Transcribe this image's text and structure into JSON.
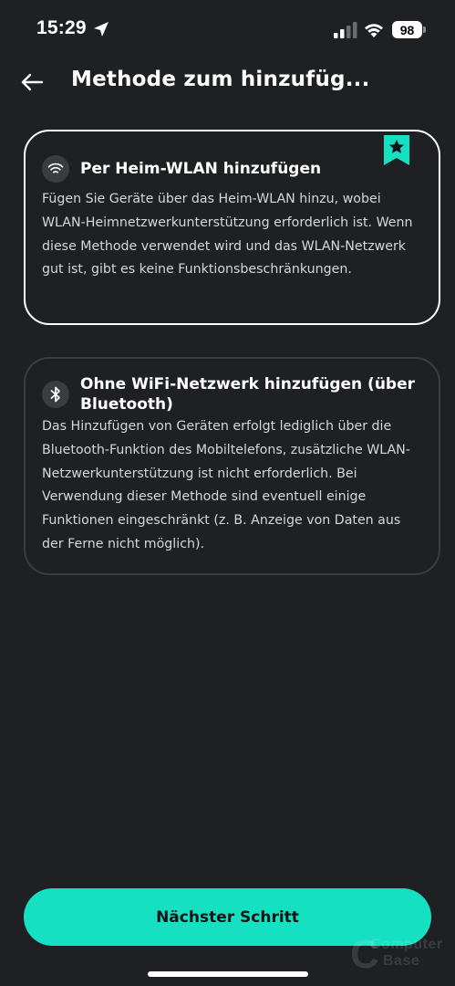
{
  "status_bar": {
    "time": "15:29",
    "battery_level": "98",
    "icons": [
      "location-arrow-icon",
      "signal-icon",
      "wifi-icon",
      "battery-icon"
    ]
  },
  "header": {
    "title": "Methode zum hinzufüg...",
    "back_icon": "arrow-left-icon"
  },
  "methods": [
    {
      "icon": "wifi-icon",
      "title": "Per Heim-WLAN hinzufügen",
      "description": "Fügen Sie Geräte über das Heim-WLAN hinzu, wobei WLAN-Heimnetzwerkunterstützung erforderlich ist. Wenn diese Methode verwendet wird und das WLAN-Netzwerk gut ist, gibt es keine Funktionsbeschränkungen.",
      "selected": true,
      "recommended_icon": "star-ribbon-icon"
    },
    {
      "icon": "bluetooth-icon",
      "title": "Ohne WiFi-Netzwerk hinzufügen (über Bluetooth)",
      "description": "Das Hinzufügen von Geräten erfolgt lediglich über die Bluetooth-Funktion des Mobiltelefons, zusätzliche WLAN-Netzwerkunterstützung ist nicht erforderlich. Bei Verwendung dieser Methode sind eventuell einige Funktionen eingeschränkt (z. B. Anzeige von Daten aus der Ferne nicht möglich).",
      "selected": false
    }
  ],
  "footer": {
    "next_button_label": "Nächster Schritt"
  },
  "watermark": {
    "line1": "Computer",
    "line2": "Base"
  },
  "colors": {
    "background": "#1f2024",
    "accent": "#16e0c2",
    "card_selected_border": "#ffffff",
    "card_border": "#3a3c41"
  }
}
